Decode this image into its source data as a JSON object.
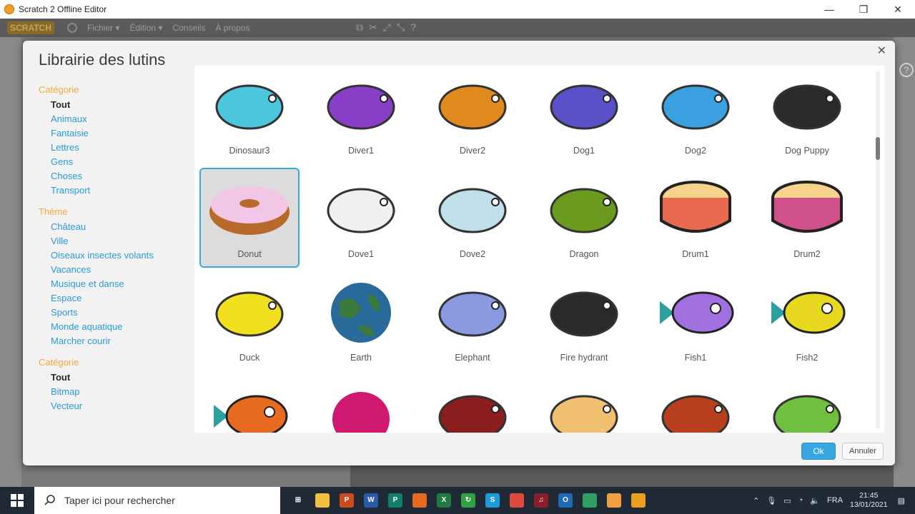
{
  "window": {
    "title": "Scratch 2 Offline Editor"
  },
  "menubar": {
    "logo": "SCRATCH",
    "items": [
      "Fichier ▾",
      "Édition ▾",
      "Conseils",
      "À propos"
    ]
  },
  "dialog": {
    "title": "Librairie des lutins",
    "ok_label": "Ok",
    "cancel_label": "Annuler",
    "sections": [
      {
        "title": "Catégorie",
        "items": [
          "Tout",
          "Animaux",
          "Fantaisie",
          "Lettres",
          "Gens",
          "Choses",
          "Transport"
        ],
        "active": 0
      },
      {
        "title": "Thème",
        "items": [
          "Château",
          "Ville",
          "Oiseaux insectes volants",
          "Vacances",
          "Musique et danse",
          "Espace",
          "Sports",
          "Monde aquatique",
          "Marcher courir"
        ],
        "active": -1
      },
      {
        "title": "Catégorie",
        "items": [
          "Tout",
          "Bitmap",
          "Vecteur"
        ],
        "active": 0
      }
    ],
    "sprites": [
      {
        "name": "Dinosaur3",
        "icon": "dinosaur-icon",
        "color": "#4cc6dc"
      },
      {
        "name": "Diver1",
        "icon": "diver-icon",
        "color": "#8a3ec8"
      },
      {
        "name": "Diver2",
        "icon": "diver-icon",
        "color": "#e08a1e"
      },
      {
        "name": "Dog1",
        "icon": "dog-icon",
        "color": "#5a50c8"
      },
      {
        "name": "Dog2",
        "icon": "dog-icon",
        "color": "#3aa0e0"
      },
      {
        "name": "Dog Puppy",
        "icon": "puppy-icon",
        "color": "#2a2a2a"
      },
      {
        "name": "Donut",
        "icon": "donut-icon",
        "color": "#b86a2a",
        "selected": true
      },
      {
        "name": "Dove1",
        "icon": "dove-icon",
        "color": "#f0f0f0"
      },
      {
        "name": "Dove2",
        "icon": "dove-icon",
        "color": "#bfe0e8"
      },
      {
        "name": "Dragon",
        "icon": "dragon-icon",
        "color": "#6a9a1e"
      },
      {
        "name": "Drum1",
        "icon": "drum-icon",
        "color": "#e86a50"
      },
      {
        "name": "Drum2",
        "icon": "drum-icon",
        "color": "#d0508a"
      },
      {
        "name": "Duck",
        "icon": "duck-icon",
        "color": "#f0e020"
      },
      {
        "name": "Earth",
        "icon": "earth-icon",
        "color": "#2a6a9a"
      },
      {
        "name": "Elephant",
        "icon": "elephant-icon",
        "color": "#8a9ae0"
      },
      {
        "name": "Fire hydrant",
        "icon": "hydrant-icon",
        "color": "#2a2a2a"
      },
      {
        "name": "Fish1",
        "icon": "fish-icon",
        "color": "#a070e0"
      },
      {
        "name": "Fish2",
        "icon": "fish-icon",
        "color": "#e8d820"
      },
      {
        "name": "",
        "icon": "fish-icon",
        "color": "#e86a20"
      },
      {
        "name": "",
        "icon": "blob-icon",
        "color": "#d01870"
      },
      {
        "name": "",
        "icon": "football-player-icon",
        "color": "#8a1e1e"
      },
      {
        "name": "",
        "icon": "fortune-cookie-icon",
        "color": "#f0c070"
      },
      {
        "name": "",
        "icon": "fox-icon",
        "color": "#b8401e"
      },
      {
        "name": "",
        "icon": "frog-icon",
        "color": "#70c040"
      }
    ]
  },
  "taskbar": {
    "search_placeholder": "Taper ici pour rechercher",
    "lang": "FRA",
    "time": "21:45",
    "date": "13/01/2021",
    "apps": [
      {
        "icon": "task-view-icon",
        "color": "#1f2a36",
        "label": "⊞"
      },
      {
        "icon": "file-explorer-icon",
        "color": "#f0c040",
        "label": ""
      },
      {
        "icon": "powerpoint-icon",
        "color": "#d04a20",
        "label": "P"
      },
      {
        "icon": "word-icon",
        "color": "#2a5aa8",
        "label": "W"
      },
      {
        "icon": "publisher-icon",
        "color": "#10806a",
        "label": "P"
      },
      {
        "icon": "firefox-icon",
        "color": "#e86a20",
        "label": ""
      },
      {
        "icon": "excel-icon",
        "color": "#1e7a40",
        "label": "X"
      },
      {
        "icon": "sync-icon",
        "color": "#30a040",
        "label": "↻"
      },
      {
        "icon": "skype-icon",
        "color": "#1e9ad6",
        "label": "S"
      },
      {
        "icon": "paint-icon",
        "color": "#e04a3a",
        "label": ""
      },
      {
        "icon": "media-icon",
        "color": "#8a1e2a",
        "label": "♫"
      },
      {
        "icon": "outlook-icon",
        "color": "#1e6ab8",
        "label": "O"
      },
      {
        "icon": "app-green-icon",
        "color": "#30a060",
        "label": ""
      },
      {
        "icon": "app-orange-icon",
        "color": "#f0a040",
        "label": ""
      },
      {
        "icon": "scratch-icon",
        "color": "#e8a020",
        "label": ""
      }
    ]
  }
}
